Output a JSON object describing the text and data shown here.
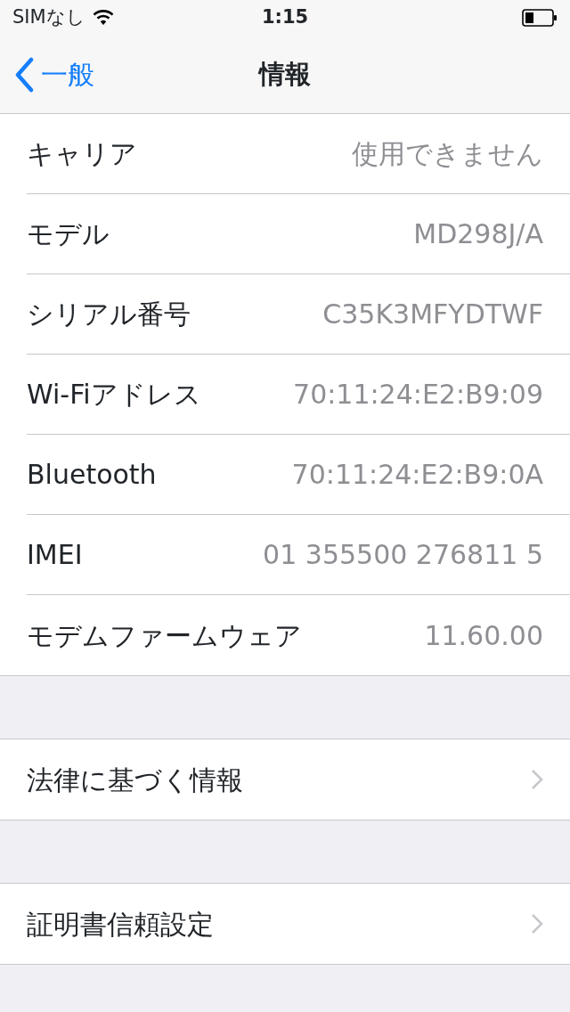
{
  "status_bar": {
    "carrier": "SIMなし",
    "time": "1:15"
  },
  "nav_bar": {
    "back_label": "一般",
    "title": "情報"
  },
  "sections": [
    {
      "rows": [
        {
          "kind": "value",
          "label": "キャリア",
          "value": "使用できません"
        },
        {
          "kind": "value",
          "label": "モデル",
          "value": "MD298J/A"
        },
        {
          "kind": "value",
          "label": "シリアル番号",
          "value": "C35K3MFYDTWF"
        },
        {
          "kind": "value",
          "label": "Wi-Fiアドレス",
          "value": "70:11:24:E2:B9:09"
        },
        {
          "kind": "value",
          "label": "Bluetooth",
          "value": "70:11:24:E2:B9:0A"
        },
        {
          "kind": "value",
          "label": "IMEI",
          "value": "01 355500 276811 5"
        },
        {
          "kind": "value",
          "label": "モデムファームウェア",
          "value": "11.60.00"
        }
      ]
    },
    {
      "rows": [
        {
          "kind": "link",
          "label": "法律に基づく情報"
        }
      ]
    },
    {
      "rows": [
        {
          "kind": "link",
          "label": "証明書信頼設定"
        }
      ]
    }
  ]
}
